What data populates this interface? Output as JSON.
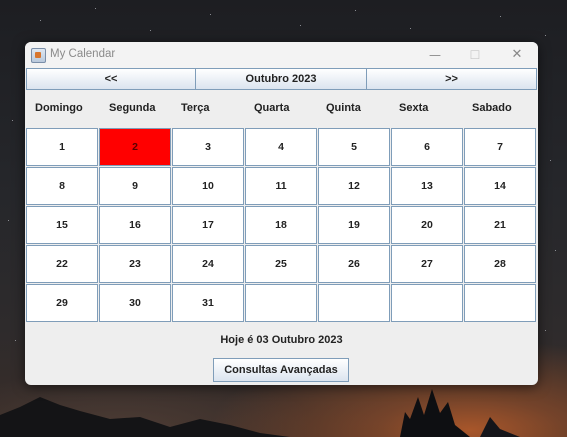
{
  "window": {
    "title": "My Calendar",
    "controls": {
      "minimize": "—",
      "maximize": "☐",
      "close": "✕"
    }
  },
  "nav": {
    "prev_label": "<<",
    "month_label": "Outubro 2023",
    "next_label": ">>"
  },
  "weekdays": [
    "Domingo",
    "Segunda",
    "Terça",
    "Quarta",
    "Quinta",
    "Sexta",
    "Sabado"
  ],
  "days": [
    [
      "1",
      "2",
      "3",
      "4",
      "5",
      "6",
      "7"
    ],
    [
      "8",
      "9",
      "10",
      "11",
      "12",
      "13",
      "14"
    ],
    [
      "15",
      "16",
      "17",
      "18",
      "19",
      "20",
      "21"
    ],
    [
      "22",
      "23",
      "24",
      "25",
      "26",
      "27",
      "28"
    ],
    [
      "29",
      "30",
      "31",
      "",
      "",
      "",
      ""
    ]
  ],
  "highlighted_day": "2",
  "highlight_color": "#ff0000",
  "today_label": "Hoje é 03 Outubro 2023",
  "advanced_button": "Consultas Avançadas"
}
